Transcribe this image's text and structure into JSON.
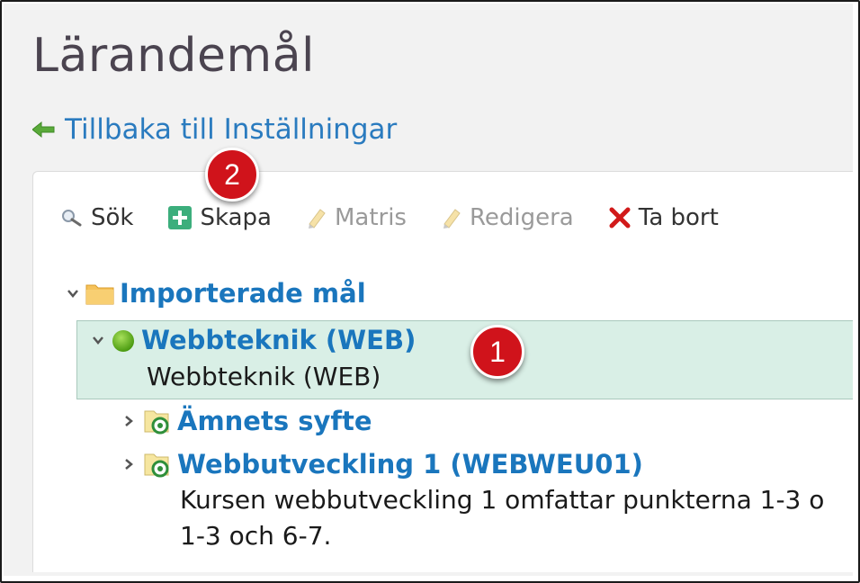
{
  "page": {
    "title": "Lärandemål",
    "back_link": "Tillbaka till Inställningar"
  },
  "toolbar": {
    "search_label": "Sök",
    "create_label": "Skapa",
    "matrix_label": "Matris",
    "edit_label": "Redigera",
    "delete_label": "Ta bort"
  },
  "tree": {
    "root": {
      "label": "Importerade mål",
      "expanded": true
    },
    "selected": {
      "title": "Webbteknik (WEB)",
      "description": "Webbteknik (WEB)",
      "expanded": true
    },
    "children": [
      {
        "title": "Ämnets syfte",
        "expanded": false
      },
      {
        "title": "Webbutveckling 1 (WEBWEU01)",
        "description_line1": "Kursen webbutveckling 1 omfattar punkterna 1-3 o",
        "description_line2": "1-3 och 6-7.",
        "expanded": false
      }
    ]
  },
  "annotations": {
    "badge1": "1",
    "badge2": "2"
  },
  "colors": {
    "link": "#2a7bbf",
    "node_title": "#1a76bd",
    "selected_bg": "#d9efe6",
    "badge": "#d0131b",
    "page_bg": "#f2f2f2"
  }
}
